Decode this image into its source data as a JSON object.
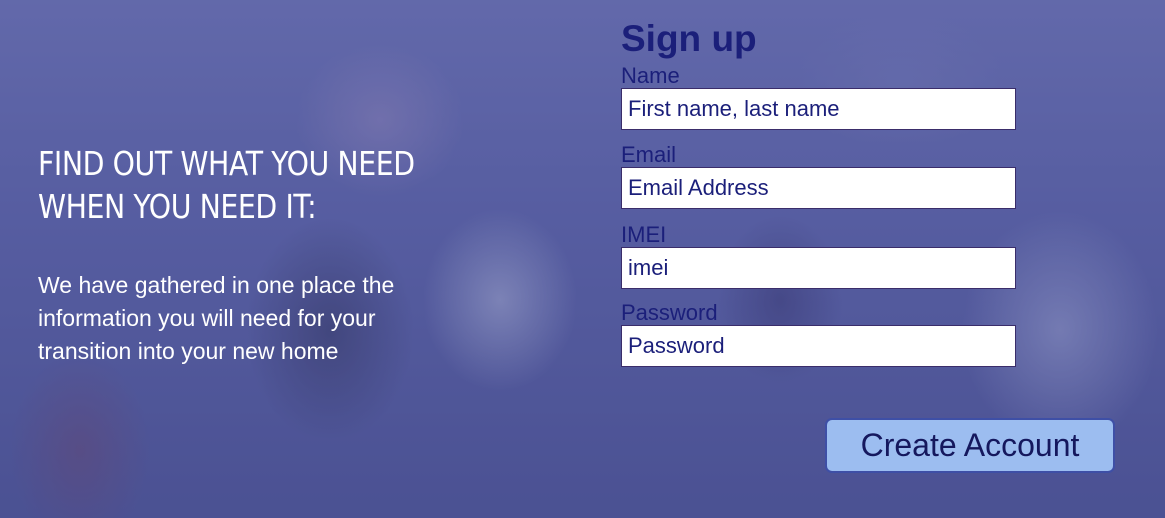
{
  "intro": {
    "heading": "FIND OUT WHAT YOU NEED WHEN YOU NEED IT:",
    "description": "We have gathered in one place the information you will need for your transition into your new home"
  },
  "signup": {
    "title": "Sign up",
    "fields": {
      "name": {
        "label": "Name",
        "placeholder": "First name, last name",
        "value": ""
      },
      "email": {
        "label": "Email",
        "placeholder": "Email Address",
        "value": ""
      },
      "imei": {
        "label": "IMEI",
        "placeholder": "imei",
        "value": ""
      },
      "password": {
        "label": "Password",
        "placeholder": "Password",
        "value": ""
      }
    },
    "submit_label": "Create Account"
  },
  "colors": {
    "form_text": "#1b1f7a",
    "button_bg": "#9cbdf0",
    "button_border": "#3e4fa6",
    "overlay": "#4e56a0"
  }
}
